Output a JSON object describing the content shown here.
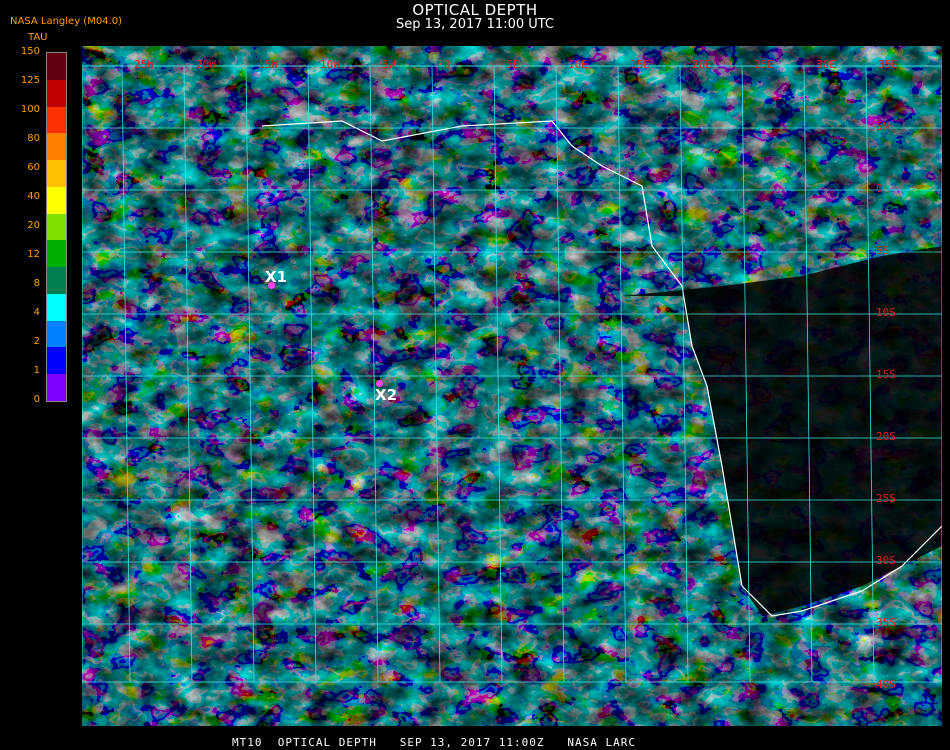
{
  "title": "OPTICAL DEPTH",
  "subtitle": "Sep 13, 2017 11:00 UTC",
  "producer": "NASA Langley (M04.0)",
  "legend": {
    "label": "TAU",
    "ticks": [
      "150",
      "125",
      "100",
      "80",
      "60",
      "40",
      "20",
      "12",
      "8",
      "4",
      "2",
      "1",
      "0"
    ],
    "colors": [
      "#600010",
      "#c00000",
      "#ff3000",
      "#ff8000",
      "#ffc000",
      "#ffff00",
      "#80e000",
      "#00b000",
      "#008050",
      "#00ffff",
      "#0080ff",
      "#0000ff",
      "#8000ff"
    ]
  },
  "longitude_labels": [
    "25W",
    "20W",
    "15W",
    "10W",
    "5W",
    "0",
    "5E",
    "10E",
    "15E",
    "20E",
    "25E",
    "30E",
    "35E"
  ],
  "latitude_labels": [
    "5N",
    "0",
    "5S",
    "10S",
    "15S",
    "20S",
    "25S",
    "30S",
    "35S",
    "40S"
  ],
  "markers": [
    {
      "label": "X1"
    },
    {
      "label": "X2"
    }
  ],
  "footer": "MT10  OPTICAL DEPTH   SEP 13, 2017 11:00Z   NASA LARC",
  "colors": {
    "grid": "#40e0e0",
    "coastline": "#ffffff",
    "label_orange": "#ffa000",
    "grid_label_red": "#e02020",
    "marker": "#ff40ff"
  }
}
